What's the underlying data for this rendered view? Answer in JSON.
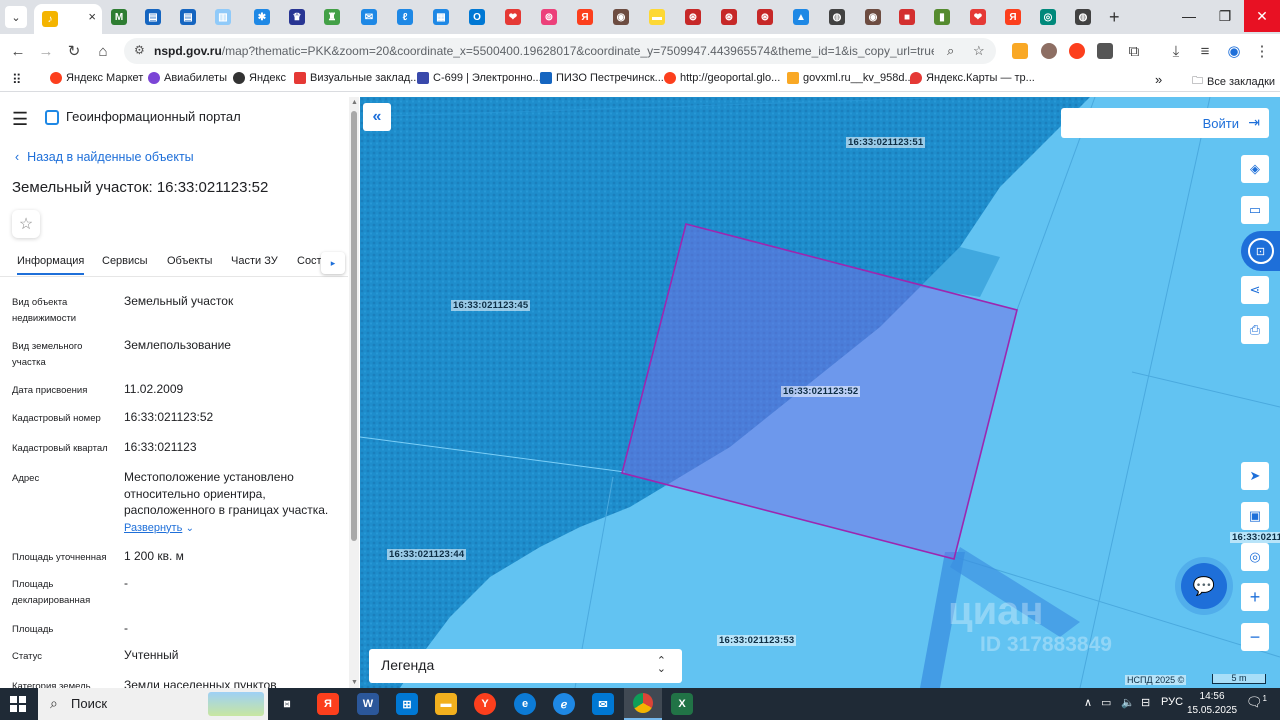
{
  "browser": {
    "url_host": "nspd.gov.ru",
    "url_path": "/map?thematic=PKK&zoom=20&coordinate_x=5500400.19628017&coordinate_y=7509947.443965574&theme_id=1&is_copy_url=true&baseLay...",
    "bookmarks": [
      {
        "label": "Яндекс Маркет",
        "color": "#fc3f1d"
      },
      {
        "label": "Авиабилеты",
        "color": "#7b45d6"
      },
      {
        "label": "Яндекс",
        "color": "#333333"
      },
      {
        "label": "Визуальные заклад...",
        "color": "#e53935"
      },
      {
        "label": "С-699 | Электронно...",
        "color": "#3949ab"
      },
      {
        "label": "ПИЗО Пестречинск...",
        "color": "#1565c0"
      },
      {
        "label": "http://geoportal.glo...",
        "color": "#fc3f1d"
      },
      {
        "label": "govxml.ru__kv_958d...",
        "color": "#f9a825"
      },
      {
        "label": "Яндекс.Карты — тр...",
        "color": "#e53935"
      }
    ],
    "bookmarks_more": "»",
    "all_bookmarks": "Все закладки",
    "tab_close": "×",
    "new_tab": "+"
  },
  "panel": {
    "portal_title": "Геоинформационный портал",
    "back_link": "Назад в найденные объекты",
    "object_title": "Земельный участок: 16:33:021123:52",
    "tabs": [
      "Информация",
      "Сервисы",
      "Объекты",
      "Части ЗУ",
      "Соста"
    ],
    "expand_label": "Развернуть",
    "rows": [
      {
        "label": "Вид объекта недвижимости",
        "value": "Земельный участок"
      },
      {
        "label": "Вид земельного участка",
        "value": "Землепользование"
      },
      {
        "label": "Дата присвоения",
        "value": "11.02.2009"
      },
      {
        "label": "Кадастровый номер",
        "value": "16:33:021123:52"
      },
      {
        "label": "Кадастровый квартал",
        "value": "16:33:021123"
      },
      {
        "label": "Адрес",
        "value": "Местоположение установлено относительно ориентира, расположенного в границах участка."
      },
      {
        "label": "Площадь уточненная",
        "value": "1 200 кв. м"
      },
      {
        "label": "Площадь декларированная",
        "value": "-"
      },
      {
        "label": "Площадь",
        "value": "-"
      },
      {
        "label": "Статус",
        "value": "Учтенный"
      },
      {
        "label": "Категория земель",
        "value": "Земли населенных пунктов"
      }
    ]
  },
  "map": {
    "login_label": "Войти",
    "legend_label": "Легенда",
    "labels": {
      "p51": "16:33:021123:51",
      "p45": "16:33:021123:45",
      "p52": "16:33:021123:52",
      "p44": "16:33:021123:44",
      "p53": "16:33:021123:53",
      "p_edge": "16:33:0211"
    },
    "watermark": "циан",
    "watermark_id": "ID 317883849",
    "copyright": "НСПД 2025 ©",
    "scale_label": "5 m",
    "colors": {
      "parcel_outline": "#9c27b0",
      "forest": "#1d8ccb",
      "field": "#62c3f2",
      "accent": "#1e6fd9"
    }
  },
  "taskbar": {
    "search_label": "Поиск",
    "lang": "РУС",
    "time": "14:56",
    "date": "15.05.2025",
    "notifications": "1"
  }
}
